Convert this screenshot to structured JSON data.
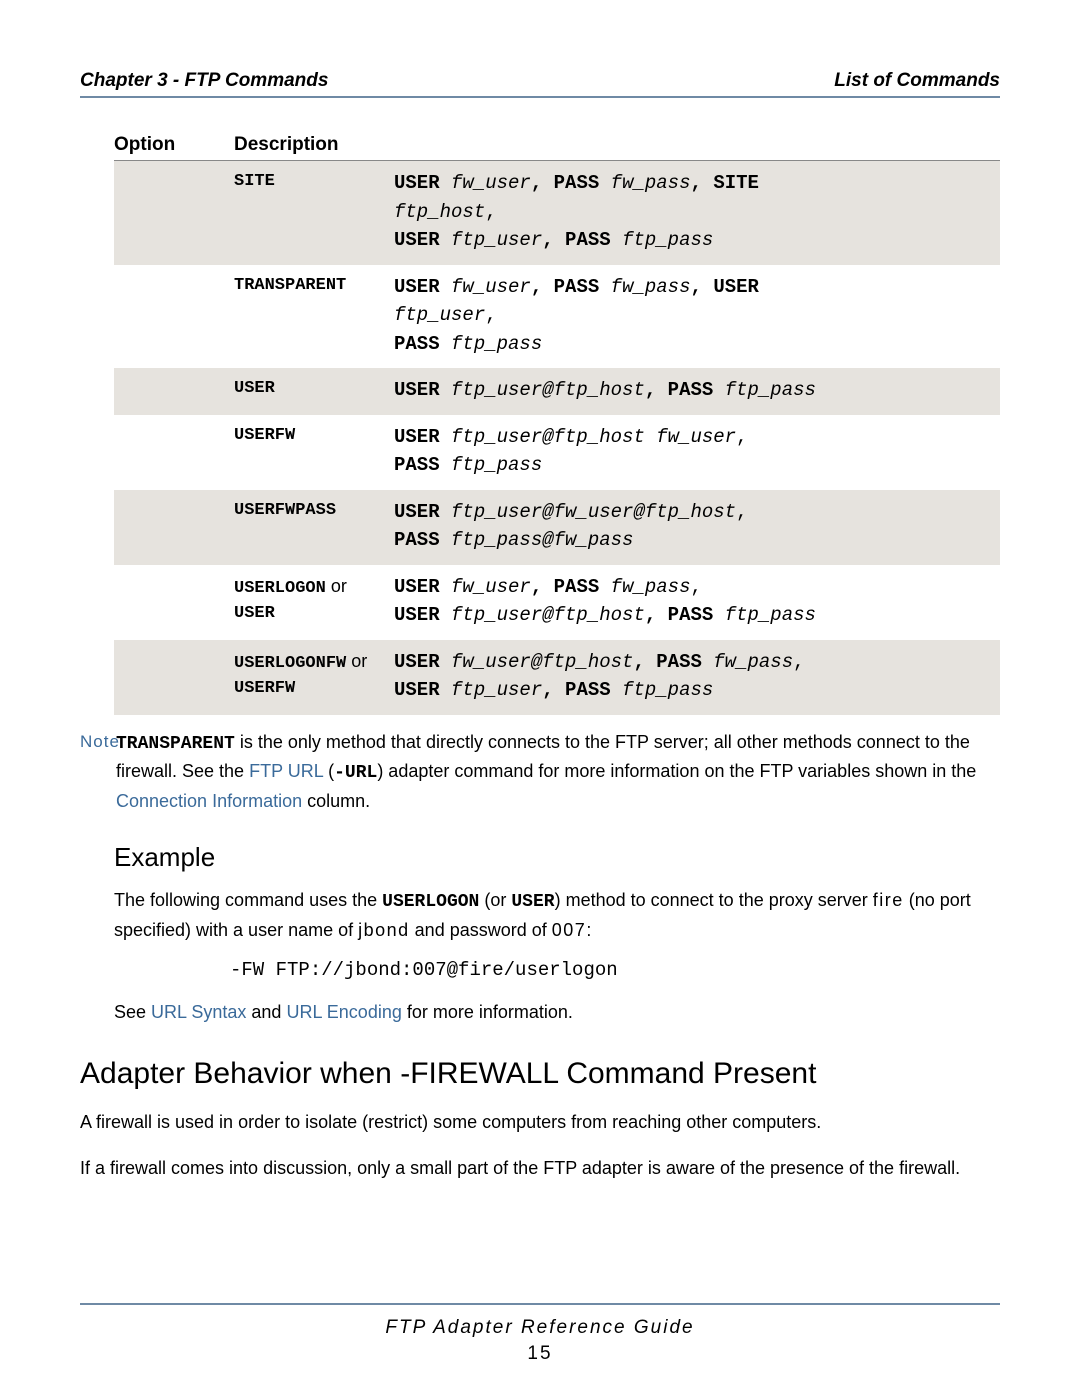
{
  "header": {
    "left": "Chapter 3 - FTP Commands",
    "right": "List of Commands"
  },
  "table": {
    "headers": {
      "option": "Option",
      "description": "Description"
    },
    "rows": [
      {
        "alt": true,
        "method": [
          {
            "t": "SITE",
            "b": true
          }
        ],
        "conn": [
          {
            "t": "USER ",
            "b": true
          },
          {
            "t": "fw_user",
            "i": true
          },
          {
            "t": ", ",
            "b": true
          },
          {
            "t": "PASS ",
            "b": true
          },
          {
            "t": "fw_pass",
            "i": true
          },
          {
            "t": ", ",
            "b": true
          },
          {
            "t": "SITE",
            "b": true
          },
          {
            "t": "\n"
          },
          {
            "t": "ftp_host",
            "i": true
          },
          {
            "t": ",\n"
          },
          {
            "t": "USER ",
            "b": true
          },
          {
            "t": "ftp_user",
            "i": true
          },
          {
            "t": ", ",
            "b": true
          },
          {
            "t": "PASS ",
            "b": true
          },
          {
            "t": "ftp_pass",
            "i": true
          }
        ]
      },
      {
        "alt": false,
        "method": [
          {
            "t": "TRANSPARENT",
            "b": true
          }
        ],
        "conn": [
          {
            "t": "USER ",
            "b": true
          },
          {
            "t": "fw_user",
            "i": true
          },
          {
            "t": ", ",
            "b": true
          },
          {
            "t": "PASS ",
            "b": true
          },
          {
            "t": "fw_pass",
            "i": true
          },
          {
            "t": ", ",
            "b": true
          },
          {
            "t": "USER",
            "b": true
          },
          {
            "t": "\n"
          },
          {
            "t": "ftp_user",
            "i": true
          },
          {
            "t": ",\n"
          },
          {
            "t": "PASS ",
            "b": true
          },
          {
            "t": "ftp_pass",
            "i": true
          }
        ]
      },
      {
        "alt": true,
        "method": [
          {
            "t": "USER",
            "b": true
          }
        ],
        "conn": [
          {
            "t": "USER ",
            "b": true
          },
          {
            "t": "ftp_user@ftp_host",
            "i": true
          },
          {
            "t": ", ",
            "b": true
          },
          {
            "t": "PASS ",
            "b": true
          },
          {
            "t": "ftp_pass",
            "i": true
          }
        ]
      },
      {
        "alt": false,
        "method": [
          {
            "t": "USERFW",
            "b": true
          }
        ],
        "conn": [
          {
            "t": "USER ",
            "b": true
          },
          {
            "t": "ftp_user@ftp_host fw_user",
            "i": true
          },
          {
            "t": ",\n"
          },
          {
            "t": "PASS ",
            "b": true
          },
          {
            "t": "ftp_pass",
            "i": true
          }
        ]
      },
      {
        "alt": true,
        "method": [
          {
            "t": "USERFWPASS",
            "b": true
          }
        ],
        "conn": [
          {
            "t": "USER ",
            "b": true
          },
          {
            "t": "ftp_user@fw_user@ftp_host",
            "i": true
          },
          {
            "t": ",\n"
          },
          {
            "t": "PASS ",
            "b": true
          },
          {
            "t": "ftp_pass@fw_pass",
            "i": true
          }
        ]
      },
      {
        "alt": false,
        "method": [
          {
            "t": "USERLOGON",
            "b": true
          },
          {
            "t": " or",
            "or": true
          },
          {
            "t": "\n"
          },
          {
            "t": "USER",
            "b": true
          }
        ],
        "conn": [
          {
            "t": "USER ",
            "b": true
          },
          {
            "t": "fw_user",
            "i": true
          },
          {
            "t": ", ",
            "b": true
          },
          {
            "t": "PASS ",
            "b": true
          },
          {
            "t": "fw_pass",
            "i": true
          },
          {
            "t": ",\n"
          },
          {
            "t": "USER ",
            "b": true
          },
          {
            "t": "ftp_user@ftp_host",
            "i": true
          },
          {
            "t": ", ",
            "b": true
          },
          {
            "t": "PASS ",
            "b": true
          },
          {
            "t": "ftp_pass",
            "i": true
          }
        ]
      },
      {
        "alt": true,
        "method": [
          {
            "t": "USERLOGONFW",
            "b": true
          },
          {
            "t": " or",
            "or": true
          },
          {
            "t": "\n"
          },
          {
            "t": "USERFW",
            "b": true
          }
        ],
        "conn": [
          {
            "t": "USER ",
            "b": true
          },
          {
            "t": "fw_user@ftp_host",
            "i": true
          },
          {
            "t": ", ",
            "b": true
          },
          {
            "t": "PASS ",
            "b": true
          },
          {
            "t": "fw_pass",
            "i": true
          },
          {
            "t": ",\n"
          },
          {
            "t": "USER ",
            "b": true
          },
          {
            "t": "ftp_user",
            "i": true
          },
          {
            "t": ", ",
            "b": true
          },
          {
            "t": "PASS ",
            "b": true
          },
          {
            "t": "ftp_pass",
            "i": true
          }
        ]
      }
    ]
  },
  "note": {
    "label": "Note",
    "segments": [
      {
        "t": "TRANSPARENT",
        "tb": true
      },
      {
        "t": " is the only method that directly connects to the FTP server; all other methods connect to the firewall. See the "
      },
      {
        "t": "FTP URL",
        "link": true
      },
      {
        "t": " ("
      },
      {
        "t": "-URL",
        "cb": true
      },
      {
        "t": ") adapter command for more information on the FTP variables shown in the "
      },
      {
        "t": "Connection Information",
        "link": true
      },
      {
        "t": " column."
      }
    ]
  },
  "example": {
    "heading": "Example",
    "para_segments": [
      {
        "t": "The following command uses the "
      },
      {
        "t": "USERLOGON",
        "sb": true
      },
      {
        "t": " (or "
      },
      {
        "t": "USER",
        "sb": true
      },
      {
        "t": ")  method to connect to the proxy server "
      },
      {
        "t": "fire",
        "ls": true
      },
      {
        "t": " (no port specified) with a user name of "
      },
      {
        "t": "jbond",
        "ls": true
      },
      {
        "t": " and password of "
      },
      {
        "t": "007",
        "ls": true
      },
      {
        "t": ":"
      }
    ],
    "code": "-FW FTP://jbond:007@fire/userlogon",
    "see_segments": [
      {
        "t": "See "
      },
      {
        "t": "URL Syntax",
        "link": true
      },
      {
        "t": " and "
      },
      {
        "t": "URL Encoding",
        "link": true
      },
      {
        "t": " for more information."
      }
    ]
  },
  "section": {
    "heading": "Adapter Behavior when -FIREWALL Command Present",
    "p1": "A firewall is used in order to isolate (restrict) some computers from reaching other computers.",
    "p2": "If a firewall comes into discussion, only a small part of the FTP adapter is aware of the presence of the firewall."
  },
  "footer": {
    "title": "FTP Adapter Reference Guide",
    "page": "15"
  }
}
